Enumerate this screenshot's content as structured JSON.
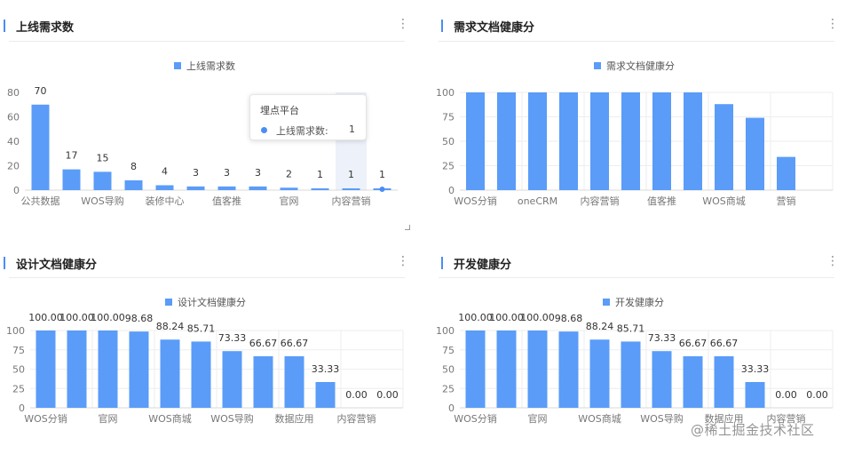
{
  "watermark": "@稀土掘金技术社区",
  "icons": {
    "menu": "more-vertical-icon"
  },
  "colors": {
    "bar": "#5a9cf8",
    "accent": "#4c8cf5",
    "grid": "#eeeeee",
    "axis": "#999999"
  },
  "panels": [
    {
      "title": "上线需求数",
      "chart_data": {
        "type": "bar",
        "legend": "上线需求数",
        "categories": [
          "公共数据",
          "",
          "WOS导购",
          "",
          "装修中心",
          "",
          "值客推",
          "",
          "官网",
          "",
          "内容营销",
          ""
        ],
        "values": [
          70,
          17,
          15,
          8,
          4,
          3,
          3,
          3,
          2,
          1,
          1,
          1
        ],
        "value_labels": [
          "70",
          "17",
          "15",
          "8",
          "4",
          "3",
          "3",
          "3",
          "2",
          "1",
          "1",
          "1"
        ],
        "y_ticks": [
          "0",
          "20",
          "40",
          "60",
          "80"
        ],
        "ylim": [
          0,
          80
        ],
        "grid": false
      },
      "tooltip": {
        "title": "埋点平台",
        "label": "上线需求数:",
        "value": "1"
      }
    },
    {
      "title": "需求文档健康分",
      "chart_data": {
        "type": "bar",
        "legend": "需求文档健康分",
        "categories": [
          "WOS分销",
          "",
          "oneCRM",
          "",
          "内容营销",
          "",
          "值客推",
          "",
          "WOS商城",
          "",
          "营销",
          ""
        ],
        "values": [
          100,
          100,
          100,
          100,
          100,
          100,
          100,
          100,
          88,
          74,
          34,
          0
        ],
        "value_labels": [],
        "y_ticks": [
          "0",
          "25",
          "50",
          "75",
          "100"
        ],
        "ylim": [
          0,
          100
        ],
        "grid": true
      }
    },
    {
      "title": "设计文档健康分",
      "chart_data": {
        "type": "bar",
        "legend": "设计文档健康分",
        "categories": [
          "WOS分销",
          "",
          "官网",
          "",
          "WOS商城",
          "",
          "WOS导购",
          "",
          "数据应用",
          "",
          "内容营销",
          ""
        ],
        "values": [
          100,
          100,
          100,
          98.68,
          88.24,
          85.71,
          73.33,
          66.67,
          66.67,
          33.33,
          0,
          0
        ],
        "value_labels": [
          "100.00",
          "100.00",
          "100.00",
          "98.68",
          "88.24",
          "85.71",
          "73.33",
          "66.67",
          "66.67",
          "33.33",
          "0.00",
          "0.00"
        ],
        "y_ticks": [
          "0",
          "25",
          "50",
          "75",
          "100"
        ],
        "ylim": [
          0,
          100
        ],
        "grid": true
      }
    },
    {
      "title": "开发健康分",
      "chart_data": {
        "type": "bar",
        "legend": "开发健康分",
        "categories": [
          "WOS分销",
          "",
          "官网",
          "",
          "WOS商城",
          "",
          "WOS导购",
          "",
          "数据应用",
          "",
          "内容营销",
          ""
        ],
        "values": [
          100,
          100,
          100,
          98.68,
          88.24,
          85.71,
          73.33,
          66.67,
          66.67,
          33.33,
          0,
          0
        ],
        "value_labels": [
          "100.00",
          "100.00",
          "100.00",
          "98.68",
          "88.24",
          "85.71",
          "73.33",
          "66.67",
          "66.67",
          "33.33",
          "0.00",
          "0.00"
        ],
        "y_ticks": [
          "0",
          "25",
          "50",
          "75",
          "100"
        ],
        "ylim": [
          0,
          100
        ],
        "grid": true
      }
    }
  ]
}
